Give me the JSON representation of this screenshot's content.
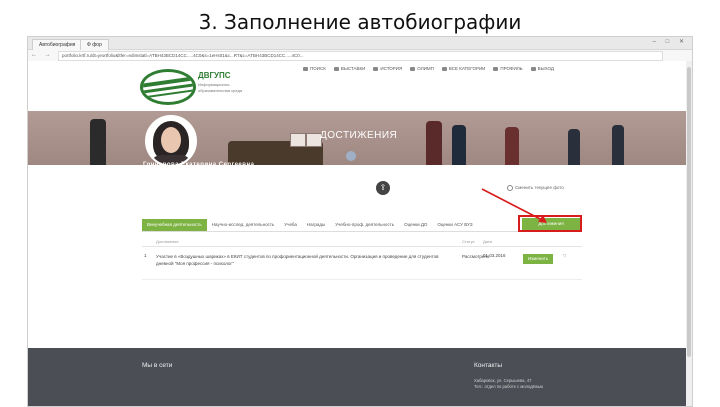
{
  "slide_title": "3. Заполнение автобиографии",
  "browser": {
    "tabs": [
      "Автобиография",
      "Ф фор"
    ],
    "url": "portfolio.krtf.ru/dt=jeortfolio&ltfer=ediInstatl=ATBH43BCD14CC.....4C0&s=1eHs01&c...RT&c=ATBH43BCD14CC.....4C0..."
  },
  "site": {
    "logo_name": "ДВГУПС",
    "logo_sub": "Информационно-образовательная среда",
    "nav": [
      "ПОИСК",
      "ВЫСТАВКИ",
      "ИСТОРИЯ",
      "ОЛИМП",
      "ВСЕ КАТЕГОРИИ",
      "ПРОФИЛЬ",
      "ВЫХОД"
    ],
    "banner_title": "ДОСТИЖЕНИЯ",
    "user_name": "Гончарова Екатерина Сергеевна",
    "change_photo": "Сменить текущее фото"
  },
  "tabs": [
    "Внеучебная деятельность",
    "Научно-исслед. деятельность",
    "Учеба",
    "Награды",
    "Учебно-проф. деятельность",
    "Оценки ДО",
    "Оценки АСУ ВУЗ"
  ],
  "add_button": "Достижения",
  "table": {
    "headers": [
      "Достижение",
      "Статус",
      "Дата"
    ],
    "rows": [
      {
        "num": "1",
        "desc": "Участие в «Воздушных шариках» в ЕКИТ студентов по профориентационной деятельности. Организация и проведение для студентов дневной \"Моя профессия - психолог\"",
        "status": "Рассмотрено",
        "date": "01.03.2016",
        "action": "Изменить"
      }
    ]
  },
  "footer": {
    "left_title": "Мы в сети",
    "right_title": "Контакты",
    "right_lines": [
      "Хабаровск, ул. Серышева, 47",
      "Тел.: отдел по работе с молодёжью"
    ]
  }
}
